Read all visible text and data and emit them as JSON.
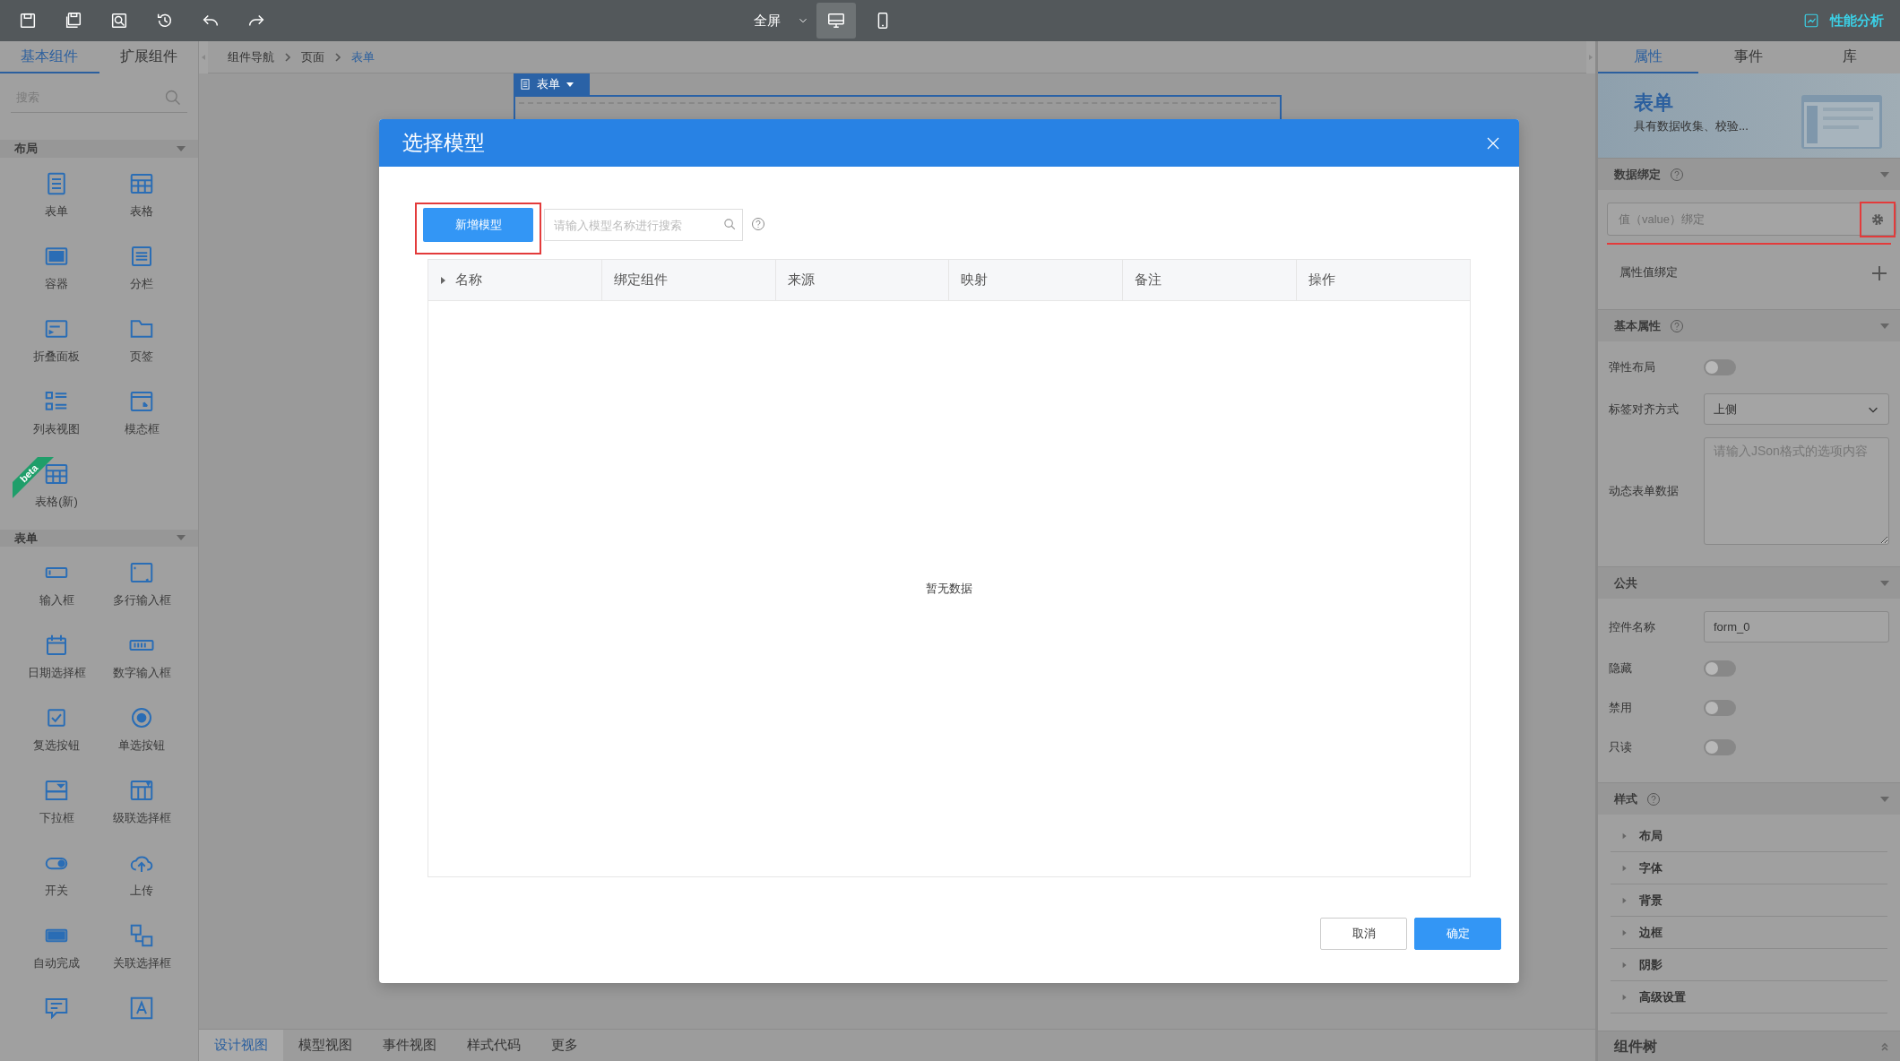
{
  "toolbar": {
    "view_mode": "全屏",
    "devices": [
      {
        "selected": true
      },
      {
        "selected": false
      }
    ],
    "perf_button": "性能分析"
  },
  "left_panel": {
    "tabs": [
      {
        "label": "基本组件",
        "selected": true
      },
      {
        "label": "扩展组件",
        "selected": false
      }
    ],
    "search": {
      "placeholder": "搜索"
    },
    "sections": [
      {
        "title": "布局",
        "expanded": true,
        "items": [
          {
            "kind": "tool",
            "label": "表单"
          },
          {
            "kind": "tool",
            "label": "表格"
          },
          {
            "kind": "tool",
            "label": "容器"
          },
          {
            "kind": "tool",
            "label": "分栏"
          },
          {
            "kind": "tool",
            "label": "折叠面板"
          },
          {
            "kind": "tool",
            "label": "页签"
          },
          {
            "kind": "tool",
            "label": "列表视图"
          },
          {
            "kind": "tool",
            "label": "模态框"
          },
          {
            "kind": "tool",
            "label": "表格(新)",
            "badge": "beta"
          }
        ]
      },
      {
        "title": "表单",
        "expanded": true,
        "items": [
          {
            "kind": "tool",
            "label": "输入框"
          },
          {
            "kind": "tool",
            "label": "多行输入框"
          },
          {
            "kind": "tool",
            "label": "日期选择框"
          },
          {
            "kind": "tool",
            "label": "数字输入框"
          },
          {
            "kind": "tool",
            "label": "复选按钮"
          },
          {
            "kind": "tool",
            "label": "单选按钮"
          },
          {
            "kind": "tool",
            "label": "下拉框"
          },
          {
            "kind": "tool",
            "label": "级联选择框"
          },
          {
            "kind": "tool",
            "label": "开关"
          },
          {
            "kind": "tool",
            "label": "上传"
          },
          {
            "kind": "tool",
            "label": "自动完成"
          },
          {
            "kind": "tool",
            "label": "关联选择框"
          },
          {
            "kind": "icon"
          },
          {
            "kind": "icon"
          }
        ]
      }
    ]
  },
  "breadcrumb": [
    {
      "label": "组件导航",
      "selected": false
    },
    {
      "label": "页面",
      "selected": false
    },
    {
      "label": "表单",
      "selected": true
    }
  ],
  "canvas": {
    "component_tab": "表单"
  },
  "right_panel": {
    "tabs": [
      {
        "label": "属性",
        "selected": true
      },
      {
        "label": "事件",
        "selected": false
      },
      {
        "label": "库",
        "selected": false
      }
    ],
    "header": {
      "title": "表单",
      "description": "具有数据收集、校验..."
    },
    "sections": [
      {
        "title": "数据绑定",
        "help": true,
        "expanded": true,
        "rows": [
          {
            "kind": "binding",
            "placeholder": "值（value）绑定",
            "highlighted": true
          },
          {
            "kind": "add",
            "label": "属性值绑定"
          }
        ]
      },
      {
        "title": "基本属性",
        "help": true,
        "expanded": true,
        "rows": [
          {
            "kind": "switch",
            "label": "弹性布局",
            "on": false
          },
          {
            "kind": "select",
            "label": "标签对齐方式",
            "value": "上侧"
          },
          {
            "kind": "textarea",
            "label": "动态表单数据",
            "placeholder": "请输入JSon格式的选项内容"
          }
        ]
      },
      {
        "title": "公共",
        "help": false,
        "expanded": true,
        "rows": [
          {
            "kind": "input",
            "label": "控件名称",
            "value": "form_0"
          },
          {
            "kind": "switch",
            "label": "隐藏",
            "on": false
          },
          {
            "kind": "switch",
            "label": "禁用",
            "on": false
          },
          {
            "kind": "switch",
            "label": "只读",
            "on": false
          }
        ]
      },
      {
        "title": "样式",
        "help": true,
        "expanded": true,
        "rows": [
          {
            "kind": "group",
            "label": "布局",
            "expanded": false
          },
          {
            "kind": "group",
            "label": "字体",
            "expanded": false
          },
          {
            "kind": "group",
            "label": "背景",
            "expanded": false
          },
          {
            "kind": "group",
            "label": "边框",
            "expanded": false
          },
          {
            "kind": "group",
            "label": "阴影",
            "expanded": false
          },
          {
            "kind": "group",
            "label": "高级设置",
            "expanded": false
          }
        ]
      }
    ],
    "footer": {
      "title": "组件树",
      "expanded": false
    }
  },
  "bottom_tabs": [
    {
      "label": "设计视图",
      "selected": true
    },
    {
      "label": "模型视图",
      "selected": false
    },
    {
      "label": "事件视图",
      "selected": false
    },
    {
      "label": "样式代码",
      "selected": false
    },
    {
      "label": "更多",
      "selected": false
    }
  ],
  "modal": {
    "title": "选择模型",
    "add_button": {
      "label": "新增模型",
      "highlighted": true
    },
    "search": {
      "placeholder": "请输入模型名称进行搜索"
    },
    "table": {
      "columns": [
        "名称",
        "绑定组件",
        "来源",
        "映射",
        "备注",
        "操作"
      ],
      "empty_text": "暂无数据"
    },
    "buttons": [
      {
        "kind": "secondary",
        "label": "取消"
      },
      {
        "kind": "primary",
        "label": "确定"
      }
    ]
  }
}
